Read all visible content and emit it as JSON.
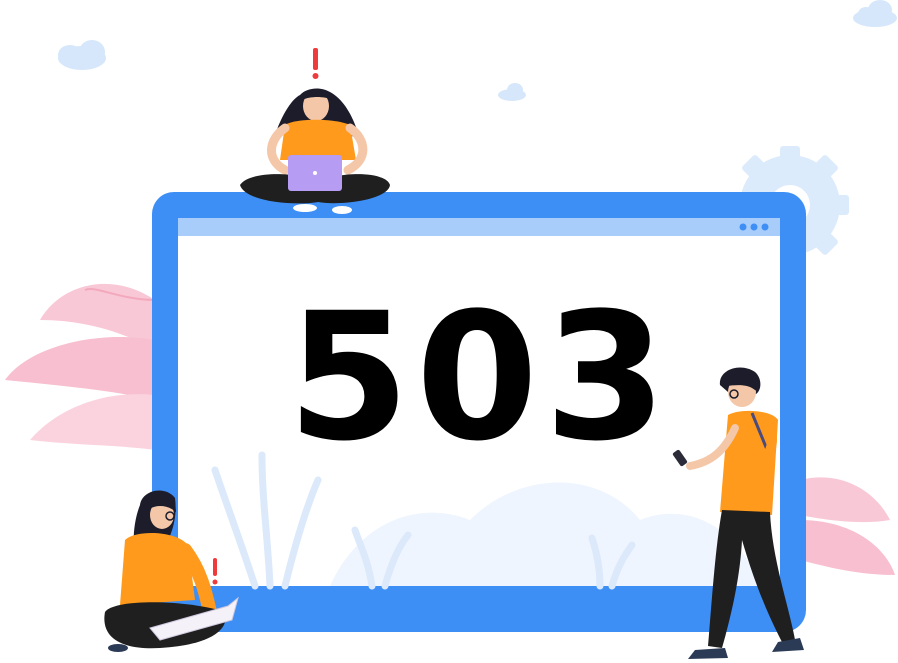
{
  "error": {
    "code": "503"
  },
  "colors": {
    "frame": "#3d8ff5",
    "frame_header": "#a9cdfb",
    "screen": "#ffffff",
    "shirt": "#ff9a1c",
    "pants": "#1f1f1f",
    "laptop": "#b79cf4",
    "alert": "#ef3b3b",
    "leaf": "#f7bfcf",
    "cloud": "#d6e7fb",
    "gear": "#d9e9fb"
  },
  "icons": {
    "window_dots": "window-dots-icon",
    "gear": "gear-icon",
    "alert": "exclamation-icon"
  }
}
